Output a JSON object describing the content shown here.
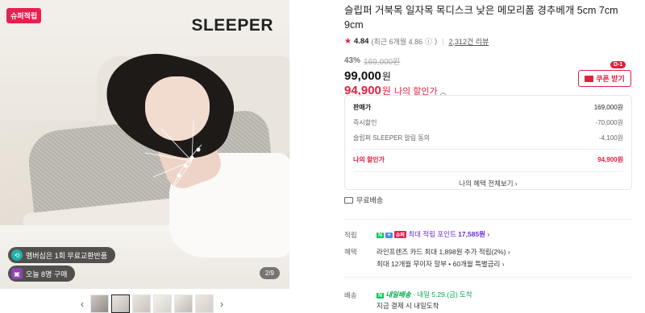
{
  "gallery": {
    "badge": "슈퍼적립",
    "brand": "SLEEPER",
    "promo_1": "멤버십은 1회 무료교환반품",
    "promo_2": "오늘 8명 구매",
    "counter": "2/9",
    "prev": "‹",
    "next": "›",
    "thumb_count": 6,
    "active_thumb": 2
  },
  "product": {
    "title": "슬립퍼 거북목 일자목 목디스크 낮은 메모리폼 경추베개 5cm 7cm 9cm",
    "rating": "4.84",
    "rating_recent": "(최근 6개월 4.86",
    "rating_info_icon": "ⓘ",
    "rating_close": ")",
    "separator": "|",
    "reviews": "2,312건 리뷰",
    "discount_pct": "43%",
    "original_price": "169,000원",
    "price": "99,000",
    "price_unit": "원",
    "my_price": "94,900",
    "my_price_unit": "원",
    "my_price_label": "나의 할인가",
    "coupon_label": "쿠폰 받기",
    "coupon_badge": "D-1"
  },
  "breakdown": {
    "rows": [
      {
        "label": "판매가",
        "value": "169,000원"
      },
      {
        "label": "즉시할인",
        "value": "-70,000원"
      },
      {
        "label": "슬립퍼 SLEEPER 알림 동의",
        "value": "-4,100원"
      }
    ],
    "my_label": "나의 할인가",
    "my_value": "94,900원",
    "more": "나의 혜택 전체보기 ›"
  },
  "shipping": {
    "label": "무료배송"
  },
  "benefits": {
    "points_label": "적립",
    "badge_n": "N",
    "badge_plus": "+",
    "badge_super": "슈퍼",
    "points_text": "최대 적립 포인트",
    "points_value": "17,585원",
    "points_chev": "›",
    "benefit_label": "혜택",
    "benefit_line1": "라인프렌즈 카드 최대 1,898원 추가 적립(2%) ›",
    "benefit_line2": "최대 12개월 무이자 할부 • 60개월 특별금리 ›",
    "delivery_label": "배송",
    "delivery_badge": "N",
    "delivery_type": "내일배송",
    "delivery_date": "· 내일 5.29.(금) 도착",
    "delivery_note": "지금 결제 시 내일도착"
  }
}
